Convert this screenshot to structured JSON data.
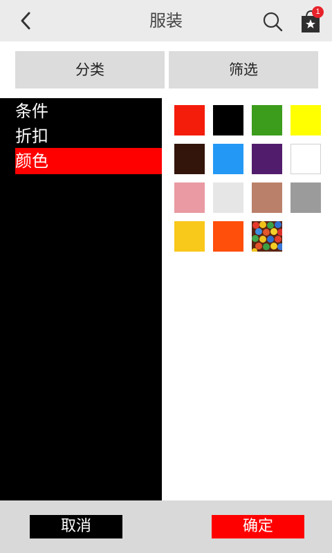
{
  "header": {
    "title": "服装",
    "back_icon": "back-arrow-icon",
    "search_icon": "search-icon",
    "cart_icon": "shopping-bag-star-icon",
    "cart_count": "1"
  },
  "tabs": [
    {
      "label": "分类"
    },
    {
      "label": "筛选"
    }
  ],
  "filter_menu": {
    "items": [
      {
        "label": "条件",
        "selected": false
      },
      {
        "label": "折扣",
        "selected": false
      },
      {
        "label": "颜色",
        "selected": true
      }
    ]
  },
  "colors": [
    {
      "name": "red",
      "hex": "#f41c0b"
    },
    {
      "name": "black",
      "hex": "#000000"
    },
    {
      "name": "green",
      "hex": "#3c9c1c"
    },
    {
      "name": "yellow",
      "hex": "#ffff00"
    },
    {
      "name": "dark-brown",
      "hex": "#33150b"
    },
    {
      "name": "sky-blue",
      "hex": "#2399f5"
    },
    {
      "name": "purple",
      "hex": "#521c6d"
    },
    {
      "name": "white",
      "hex": "#ffffff"
    },
    {
      "name": "pink",
      "hex": "#e99aa2"
    },
    {
      "name": "light-gray",
      "hex": "#e6e6e6"
    },
    {
      "name": "tan",
      "hex": "#bb806a"
    },
    {
      "name": "gray",
      "hex": "#9b9b9b"
    },
    {
      "name": "gold",
      "hex": "#f8c81a"
    },
    {
      "name": "orange",
      "hex": "#ff4f0b"
    },
    {
      "name": "multicolor",
      "hex": "multicolor"
    }
  ],
  "footer": {
    "cancel_label": "取消",
    "confirm_label": "确定"
  },
  "accent_colors": {
    "selected": "#ff0000",
    "panel": "#000000",
    "badge": "#e8222a"
  }
}
